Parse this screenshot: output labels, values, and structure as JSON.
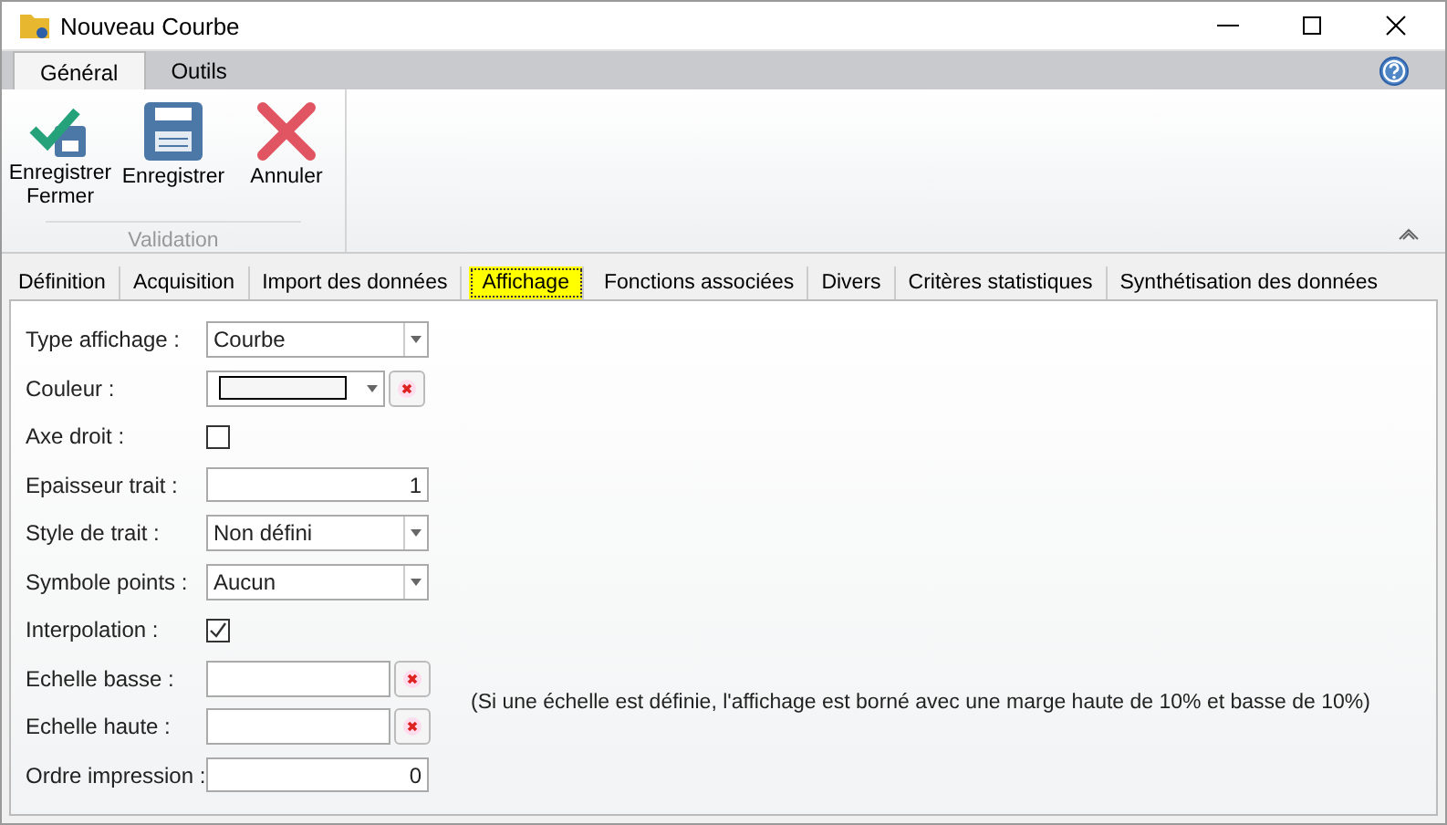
{
  "window": {
    "title": "Nouveau Courbe"
  },
  "ribbon_tabs": [
    {
      "label": "Général",
      "selected": true
    },
    {
      "label": "Outils",
      "selected": false
    }
  ],
  "ribbon_group": {
    "label": "Validation",
    "buttons": [
      {
        "kind": "save-close",
        "label": "Enregistrer Fermer"
      },
      {
        "kind": "save",
        "label": "Enregistrer"
      },
      {
        "kind": "cancel",
        "label": "Annuler"
      }
    ]
  },
  "tabs": [
    {
      "label": "Définition",
      "selected": false
    },
    {
      "label": "Acquisition",
      "selected": false
    },
    {
      "label": "Import des données",
      "selected": false
    },
    {
      "label": "Affichage",
      "selected": true
    },
    {
      "label": "Fonctions associées",
      "selected": false
    },
    {
      "label": "Divers",
      "selected": false
    },
    {
      "label": "Critères statistiques",
      "selected": false
    },
    {
      "label": "Synthétisation des données",
      "selected": false
    }
  ],
  "fields": [
    {
      "label": "Type affichage :",
      "kind": "combo",
      "value": "Courbe"
    },
    {
      "label": "Couleur :",
      "kind": "color"
    },
    {
      "label": "Axe droit :",
      "kind": "checkbox",
      "checked": false
    },
    {
      "label": "Epaisseur trait :",
      "kind": "number",
      "value": "1"
    },
    {
      "label": "Style de trait :",
      "kind": "combo",
      "value": "Non défini"
    },
    {
      "label": "Symbole points :",
      "kind": "combo",
      "value": "Aucun"
    },
    {
      "label": "Interpolation :",
      "kind": "checkbox",
      "checked": true
    },
    {
      "label": "Echelle basse :",
      "kind": "clearable"
    },
    {
      "label": "Echelle haute :",
      "kind": "clearable"
    },
    {
      "label": "Ordre impression :",
      "kind": "number",
      "value": "0"
    }
  ],
  "note": "(Si une échelle est définie, l'affichage est borné avec une marge haute de 10% et basse de 10%)"
}
